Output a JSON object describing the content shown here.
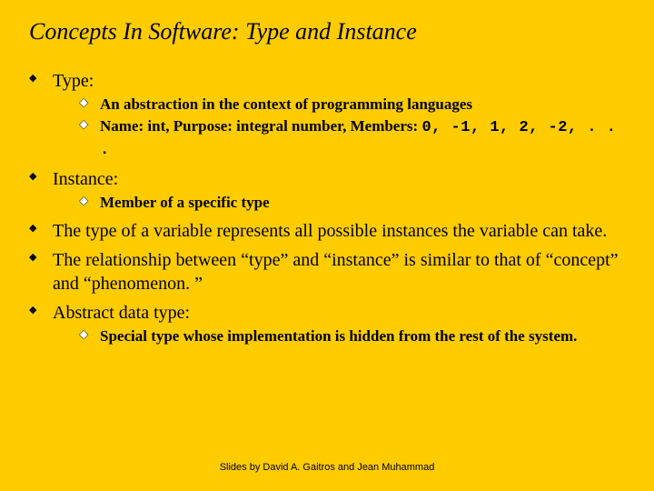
{
  "title": "Concepts In Software: Type and Instance",
  "items": {
    "type_label": "Type:",
    "type_sub": {
      "a": "An abstraction in the context of programming languages",
      "b_label": "Name: int, Purpose: integral number, Members: ",
      "b_mono": "0, -1, 1, 2, -2, . . ."
    },
    "instance_label": "Instance:",
    "instance_sub": {
      "a": "Member of a specific type"
    },
    "bullet3": "The type of a variable represents all possible instances the variable can take.",
    "bullet4": "The relationship between “type” and “instance” is similar to that of “concept” and “phenomenon. ”",
    "bullet5": "Abstract data type:",
    "adt_sub": {
      "a": "Special type whose implementation is hidden from the rest of the system."
    }
  },
  "footer": "Slides by David A. Gaitros and Jean Muhammad"
}
